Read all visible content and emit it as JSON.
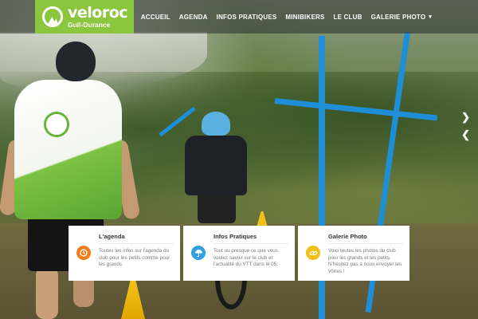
{
  "header": {
    "logo": {
      "name": "veloroc",
      "sub": "Guil-Durance"
    },
    "nav": [
      {
        "label": "ACCUEIL"
      },
      {
        "label": "AGENDA"
      },
      {
        "label": "INFOS PRATIQUES"
      },
      {
        "label": "MINIBIKERS"
      },
      {
        "label": "LE CLUB"
      },
      {
        "label": "GALERIE PHOTO",
        "has_dropdown": true
      }
    ]
  },
  "slider": {
    "next_icon": "chevron-right-icon",
    "prev_icon": "chevron-left-icon"
  },
  "cards": [
    {
      "title": "L'agenda",
      "text": "Toutes les infos sur l'agenda du club pour les petits comme pour les grands",
      "icon": "clock-icon",
      "color": "#f07d1a"
    },
    {
      "title": "Infos Pratiques",
      "text": "Tout ou presque ce que vous voulez savoir sur le club et l'actualité du VTT dans le 05.",
      "icon": "umbrella-icon",
      "color": "#2fa0e0"
    },
    {
      "title": "Galerie Photo",
      "text": "Voici toutes les photos du club pour les grands et les petits. N'hésitez pas à nous envoyer les vôtres !",
      "icon": "link-icon",
      "color": "#f2c019"
    }
  ],
  "colors": {
    "brand": "#8cc63f",
    "header_bg": "rgba(40,48,40,0.55)"
  }
}
